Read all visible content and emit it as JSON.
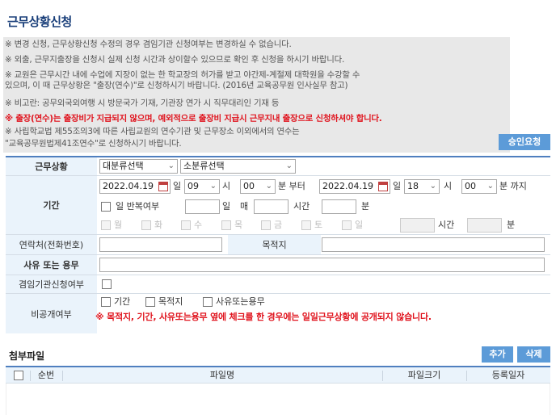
{
  "page": {
    "title": "근무상황신청"
  },
  "notices": [
    {
      "text": "※ 변경 신청, 근무상황신청 수정의 경우 겸임기관 신청여부는 변경하실 수 없습니다.",
      "red": false
    },
    {
      "text": "※ 외출, 근무지출장을 신청시 실제 신청 시간과 상이할수 있으므로 확인 후 신청을 하시기 바랍니다.",
      "red": false
    },
    {
      "text": "※ 교원은 근무시간 내에 수업에 지장이 없는 한 학교장의 허가를 받고 야간제-계절제 대학원을 수강할 수",
      "red": false
    },
    {
      "text": "있으며, 이 때 근무상황은 \"출장(연수)\"로 신청하시기 바랍니다. (2016년 교육공무원 인사실무 참고)",
      "red": false
    },
    {
      "text": "※ 비고란: 공무외국외여행 시 방문국가 기재, 기관장 연가 시 직무대리인 기재 등",
      "red": false
    },
    {
      "text": "※ 출장(연수)는 출장비가 지급되지 않으며, 예외적으로 출장비 지급시 근무지내 출장으로 신청하셔야 합니다.",
      "red": true
    },
    {
      "text": "※ 사립학교법 제55조의3에 따른 사립교원의 연수기관 및 근무장소 이외에서의 연수는",
      "red": false
    },
    {
      "text": "\"교육공무원법제41조연수\"로 신청하시기 바랍니다.",
      "red": false
    }
  ],
  "buttons": {
    "approve": "승인요청",
    "add": "추가",
    "delete": "삭제"
  },
  "form": {
    "status": {
      "label": "근무상황",
      "major": "대분류선택",
      "minor": "소분류선택"
    },
    "period": {
      "label": "기간",
      "start_date": "2022.04.19",
      "day1": "일",
      "start_hour": "09",
      "hour1": "시",
      "start_min": "00",
      "min_from": "분 부터",
      "end_date": "2022.04.19",
      "day2": "일",
      "end_hour": "18",
      "hour2": "시",
      "end_min": "00",
      "min_to": "분 까지",
      "repeat_label": "일 반복여부",
      "day_unit": "일",
      "every": "매",
      "hour_unit": "시간",
      "minute_unit": "분",
      "weekdays": [
        "월",
        "화",
        "수",
        "목",
        "금",
        "토",
        "일"
      ],
      "total_hour_unit": "시간",
      "total_min_unit": "분"
    },
    "contact": {
      "label": "연락처(전화번호)",
      "destination_label": "목적지"
    },
    "reason": {
      "label": "사유 또는 용무"
    },
    "concurrent": {
      "label": "겸임기관신청여부"
    },
    "private": {
      "label": "비공개여부",
      "options": [
        "기간",
        "목적지",
        "사유또는용무"
      ],
      "warning": "※ 목적지, 기간, 사유또는용무 옆에 체크를 한 경우에는 일일근무상황에 공개되지 않습니다."
    }
  },
  "attachments": {
    "title": "첨부파일",
    "columns": {
      "seq": "순번",
      "filename": "파일명",
      "filesize": "파일크기",
      "date": "등록일자"
    }
  }
}
